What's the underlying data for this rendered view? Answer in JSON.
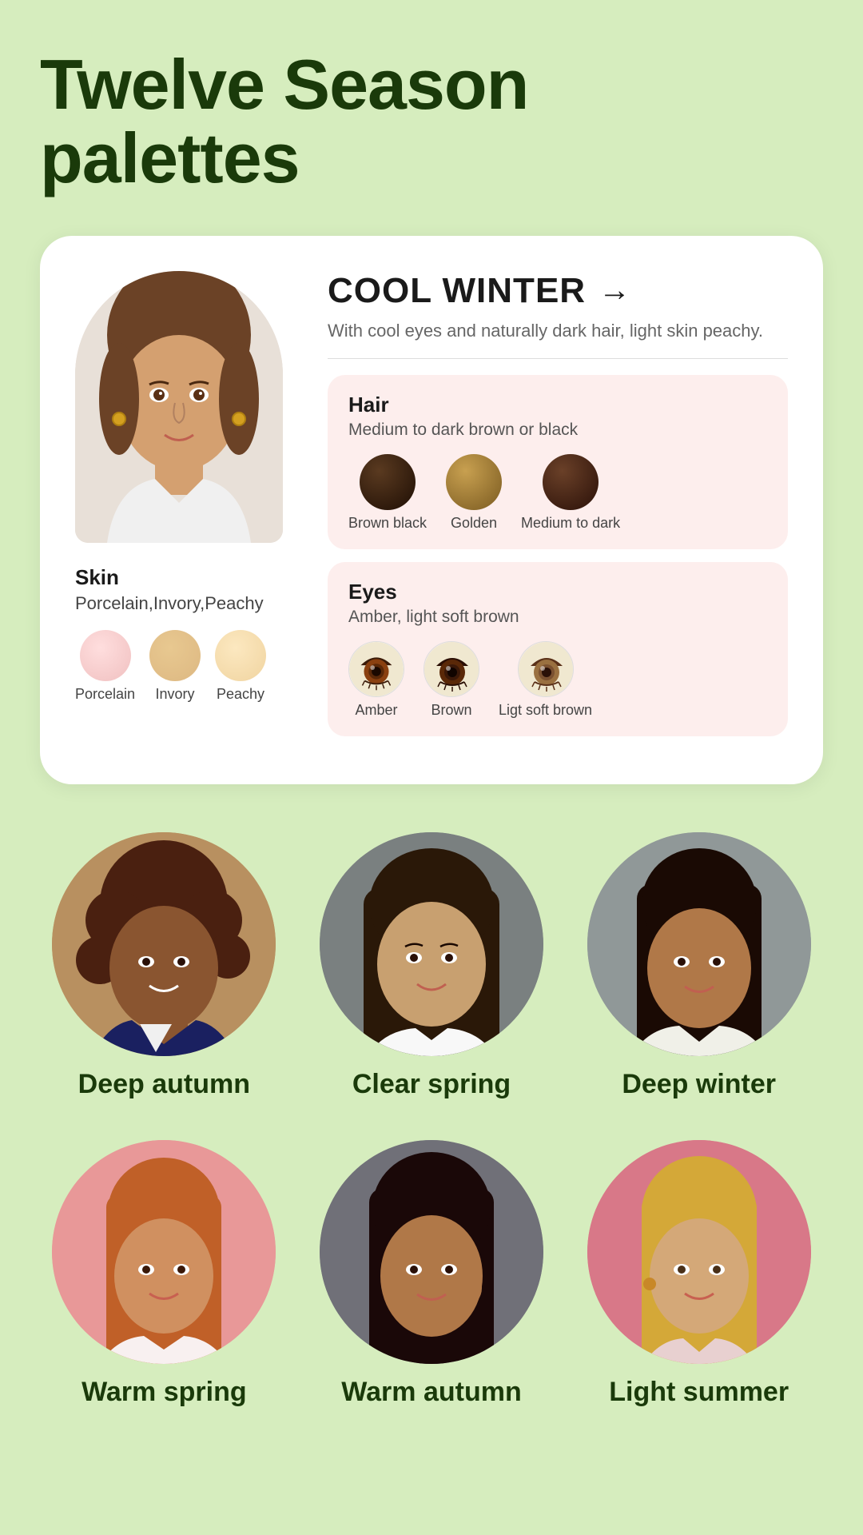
{
  "page": {
    "title_line1": "Twelve Season",
    "title_line2": "palettes"
  },
  "card": {
    "season": {
      "name": "COOL WINTER",
      "description": "With cool eyes and naturally dark hair, light skin peachy."
    },
    "skin": {
      "label": "Skin",
      "sublabel": "Porcelain,Invory,Peachy",
      "swatches": [
        {
          "name": "Porcelain",
          "color": "#f0c0c0"
        },
        {
          "name": "Invory",
          "color": "#ddb882"
        },
        {
          "name": "Peachy",
          "color": "#f0d4a0"
        }
      ]
    },
    "hair": {
      "label": "Hair",
      "sublabel": "Medium to dark brown or black",
      "swatches": [
        {
          "name": "Brown black",
          "color": "#2a1a0a"
        },
        {
          "name": "Golden",
          "color": "#9a7a30"
        },
        {
          "name": "Medium to dark",
          "color": "#4a2a18"
        }
      ]
    },
    "eyes": {
      "label": "Eyes",
      "sublabel": "Amber, light soft brown",
      "swatches": [
        {
          "name": "Amber",
          "color": "#7a3010"
        },
        {
          "name": "Brown",
          "color": "#4a2808"
        },
        {
          "name": "Ligt soft brown",
          "color": "#8a6040"
        }
      ]
    }
  },
  "portraits_row1": [
    {
      "label": "Deep autumn",
      "bg": "#c8a878",
      "face_tone": "#8a5a30"
    },
    {
      "label": "Clear spring",
      "bg": "#687878",
      "face_tone": "#c8a070"
    },
    {
      "label": "Deep winter",
      "bg": "#909898",
      "face_tone": "#b07848"
    }
  ],
  "portraits_row2": [
    {
      "label": "Warm spring",
      "bg": "#f0a0a0",
      "face_tone": "#d09060"
    },
    {
      "label": "Warm autumn",
      "bg": "#787880",
      "face_tone": "#b87848"
    },
    {
      "label": "Light summer",
      "bg": "#e08898",
      "face_tone": "#d4a878"
    }
  ],
  "icons": {
    "arrow_right": "→"
  }
}
